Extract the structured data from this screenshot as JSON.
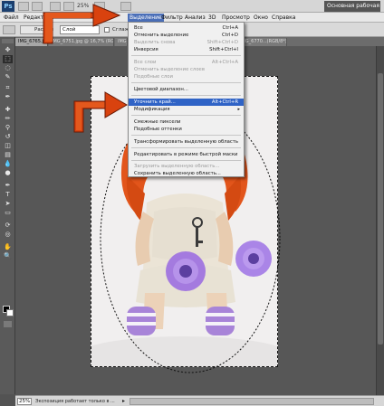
{
  "app": {
    "logo": "Ps",
    "zoom": "25%",
    "workspace": "Основная рабочая"
  },
  "menubar": [
    {
      "label": "Файл"
    },
    {
      "label": "Редактир"
    },
    {
      "label": "Выделение"
    },
    {
      "label": "Фильтр"
    },
    {
      "label": "Анализ"
    },
    {
      "label": "3D"
    },
    {
      "label": "Просмотр"
    },
    {
      "label": "Окно"
    },
    {
      "label": "Справка"
    }
  ],
  "options_bar": {
    "feather_label": "Растуш",
    "style_select": "Слой",
    "antialias_label": "Сглаживание"
  },
  "tabs": [
    {
      "label": "IMG_6765.jpg @ 25%..."
    },
    {
      "label": "IMG_6751.jpg @ 16,7% (RGB/8*)"
    },
    {
      "label": "IMG_6783.jpg @ 25% (RGB/8*)"
    },
    {
      "label": "IMG_6770...(RGB/8*)"
    }
  ],
  "dropdown": {
    "items": [
      {
        "label": "Все",
        "shortcut": "Ctrl+A",
        "disabled": false
      },
      {
        "label": "Отменить выделение",
        "shortcut": "Ctrl+D",
        "disabled": false
      },
      {
        "label": "Выделить снова",
        "shortcut": "Shift+Ctrl+D",
        "disabled": true
      },
      {
        "label": "Инверсия",
        "shortcut": "Shift+Ctrl+I",
        "disabled": false
      },
      {
        "label": "Все слои",
        "shortcut": "Alt+Ctrl+A",
        "disabled": true
      },
      {
        "label": "Отменить выделение слоев",
        "shortcut": "",
        "disabled": true
      },
      {
        "label": "Подобные слои",
        "shortcut": "",
        "disabled": true
      },
      {
        "label": "Цветовой диапазон...",
        "shortcut": "",
        "disabled": false
      },
      {
        "label": "Уточнить край...",
        "shortcut": "Alt+Ctrl+R",
        "disabled": false
      },
      {
        "label": "Модификация",
        "shortcut": "",
        "disabled": false
      },
      {
        "label": "Смежные пиксели",
        "shortcut": "",
        "disabled": false
      },
      {
        "label": "Подобные оттенки",
        "shortcut": "",
        "disabled": false
      },
      {
        "label": "Трансформировать выделенную область",
        "shortcut": "",
        "disabled": false
      },
      {
        "label": "Редактировать в режиме быстрой маски",
        "shortcut": "",
        "disabled": false
      },
      {
        "label": "Загрузить выделенную область...",
        "shortcut": "",
        "disabled": true
      },
      {
        "label": "Сохранить выделенную область...",
        "shortcut": "",
        "disabled": false
      }
    ]
  },
  "status": {
    "zoom": "25%",
    "text": "Экспозиция работает только в ..."
  },
  "colors": {
    "menu_highlight": "#2f63c6",
    "arrow_fill": "#d9420f",
    "ps_logo": "#1c3f6e"
  },
  "icons": {
    "submenu": "▸",
    "status_arrow": "▸"
  }
}
